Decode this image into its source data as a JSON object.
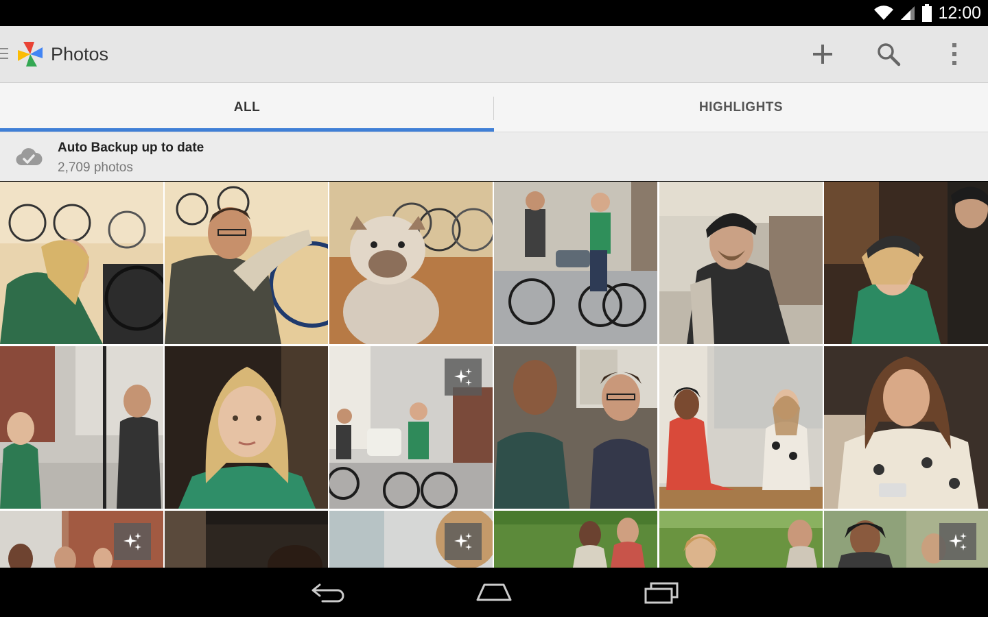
{
  "status_bar": {
    "time": "12:00",
    "icons": [
      "wifi-icon",
      "cell-signal-icon",
      "battery-icon"
    ]
  },
  "app_bar": {
    "title": "Photos",
    "actions": [
      "add-icon",
      "search-icon",
      "overflow-menu-icon"
    ]
  },
  "tabs": [
    {
      "label": "ALL",
      "selected": true
    },
    {
      "label": "HIGHLIGHTS",
      "selected": false
    }
  ],
  "backup": {
    "title": "Auto Backup up to date",
    "subtitle": "2,709 photos"
  },
  "photos": [
    {
      "subject": "woman-fixing-bike",
      "auto_awesome": false
    },
    {
      "subject": "man-with-bike",
      "auto_awesome": false
    },
    {
      "subject": "bulldog",
      "auto_awesome": false
    },
    {
      "subject": "couple-cycling",
      "auto_awesome": false
    },
    {
      "subject": "man-with-helmet",
      "auto_awesome": false
    },
    {
      "subject": "couple-helmet",
      "auto_awesome": false
    },
    {
      "subject": "couple-street",
      "auto_awesome": false
    },
    {
      "subject": "blonde-portrait",
      "auto_awesome": false
    },
    {
      "subject": "cyclists-street",
      "auto_awesome": true
    },
    {
      "subject": "two-men-cafe",
      "auto_awesome": false
    },
    {
      "subject": "women-cafe",
      "auto_awesome": false
    },
    {
      "subject": "woman-phone",
      "auto_awesome": false
    },
    {
      "subject": "friends-street",
      "auto_awesome": true
    },
    {
      "subject": "woman-doorway",
      "auto_awesome": false
    },
    {
      "subject": "woman-curly-hair",
      "auto_awesome": true
    },
    {
      "subject": "friends-park",
      "auto_awesome": false
    },
    {
      "subject": "couple-park",
      "auto_awesome": false
    },
    {
      "subject": "friends-outdoor",
      "auto_awesome": true
    }
  ],
  "colors": {
    "accent": "#3f7fd6",
    "app_bar": "#e6e6e6",
    "tab_bar": "#f5f5f5"
  },
  "nav_bar": [
    "back-icon",
    "home-icon",
    "recents-icon"
  ]
}
